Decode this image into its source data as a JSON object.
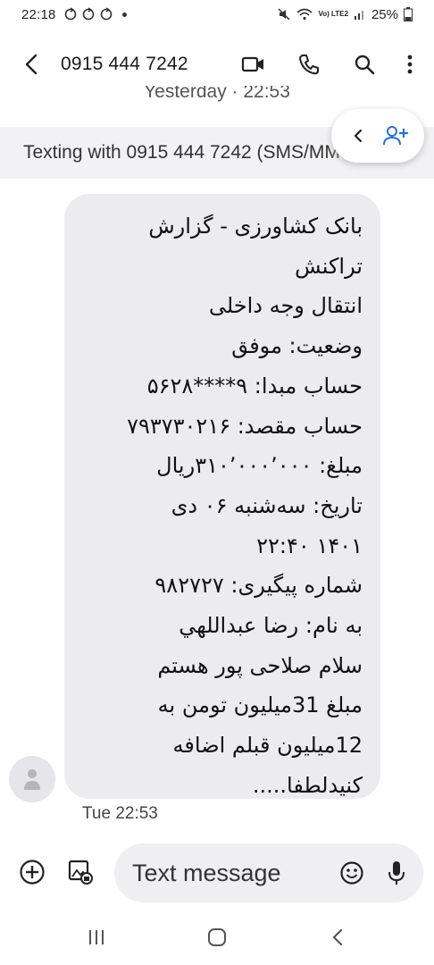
{
  "status_bar": {
    "time": "22:18",
    "network": "Vo) LTE2",
    "battery": "25%"
  },
  "header": {
    "contact": "0915 444 7242"
  },
  "date_divider": "Yesterday · 22:53",
  "banner": {
    "text": "Texting with 0915 444 7242 (SMS/MMS)"
  },
  "message": {
    "lines": [
      "بانک کشاورزی - گزارش",
      "تراکنش",
      "انتقال وجه داخلی",
      "وضعیت: موفق",
      "حساب مبدا: ۹****۵۶۲۸",
      "حساب مقصد: ۷۹۳۷۳۰۲۱۶",
      "مبلغ: ۳۱۰٬۰۰۰٬۰۰۰ریال",
      "تاریخ: سه‌شنبه ۰۶ دی",
      "۱۴۰۱ ۲۲:۴۰",
      "شماره پیگیری: ۹۸۲۷۲۷",
      "به نام: رضا عبداللهي",
      "سلام صلاحی پور هستم",
      "مبلغ 31میلیون تومن به",
      "12میلیون قبلم اضافه",
      "کنیدلطفا....."
    ],
    "timestamp": "Tue 22:53"
  },
  "composer": {
    "placeholder": "Text message"
  },
  "icons": {
    "back": "arrow-left-icon",
    "video": "video-call-icon",
    "phone": "phone-icon",
    "search": "search-icon",
    "more": "more-vert-icon",
    "add_contact": "add-person-icon",
    "add": "plus-circle-icon",
    "gallery": "gallery-icon",
    "emoji": "emoji-icon",
    "mic": "mic-icon"
  },
  "colors": {
    "accent": "#2a6fdb",
    "bubble": "#ececef",
    "banner": "#f2f2f4"
  }
}
